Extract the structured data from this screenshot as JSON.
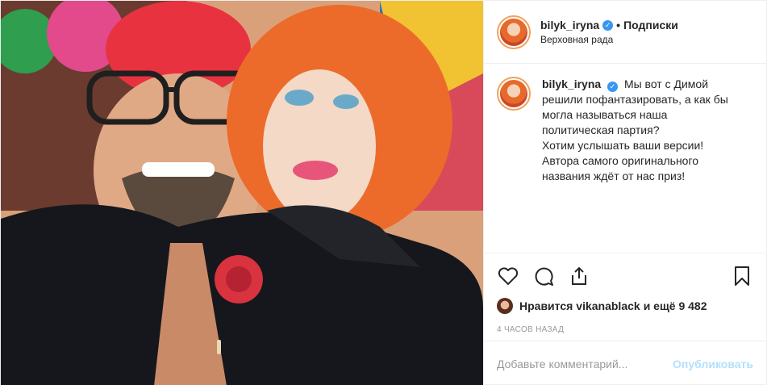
{
  "header": {
    "username": "bilyk_iryna",
    "verified_icon": "verified-badge-icon",
    "separator": "•",
    "follow_label": "Подписки",
    "location": "Верховная рада"
  },
  "caption": {
    "username": "bilyk_iryna",
    "lines": [
      "Мы вот с Димой",
      "решили пофантазировать, а как бы",
      "могла называться наша",
      "политическая партия?",
      "Хотим услышать ваши версии!",
      "Автора самого оригинального",
      "названия ждёт от нас приз!"
    ]
  },
  "actions": {
    "icons": [
      "heart-icon",
      "comment-icon",
      "share-icon",
      "bookmark-icon"
    ]
  },
  "likes": {
    "prefix": "Нравится",
    "user": "vikanablack",
    "suffix": "и ещё 9 482"
  },
  "timestamp": "4 ЧАСОВ НАЗАД",
  "comment": {
    "placeholder": "Добавьте комментарий...",
    "publish_label": "Опубликовать"
  },
  "colors": {
    "verified": "#3897f0",
    "publish_disabled": "#b2dffc",
    "story_ring": "#f0a35e"
  }
}
